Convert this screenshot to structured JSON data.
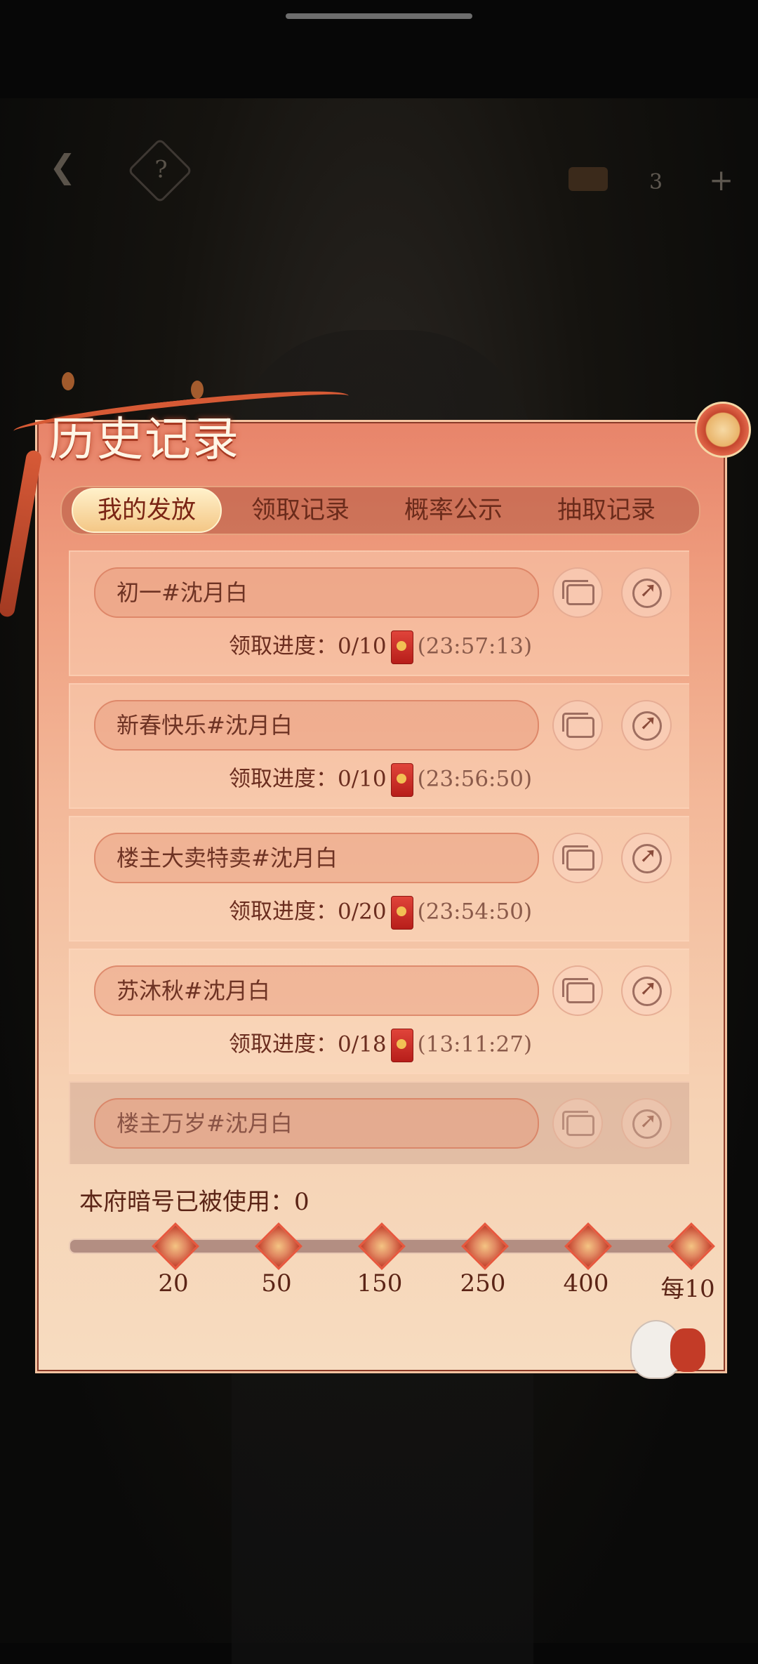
{
  "topbar": {
    "back_icon": "back-arrow-icon",
    "help_label": "?",
    "currency_count": "3",
    "plus_label": "+"
  },
  "panel": {
    "title": "历史记录",
    "tabs": [
      {
        "label": "我的发放",
        "active": true
      },
      {
        "label": "领取记录",
        "active": false
      },
      {
        "label": "概率公示",
        "active": false
      },
      {
        "label": "抽取记录",
        "active": false
      }
    ],
    "records": [
      {
        "name": "初一#沈月白",
        "progress_label": "领取进度：",
        "progress": "0/10",
        "timer": "(23:57:13)"
      },
      {
        "name": "新春快乐#沈月白",
        "progress_label": "领取进度：",
        "progress": "0/10",
        "timer": "(23:56:50)"
      },
      {
        "name": "楼主大卖特卖#沈月白",
        "progress_label": "领取进度：",
        "progress": "0/20",
        "timer": "(23:54:50)"
      },
      {
        "name": "苏沐秋#沈月白",
        "progress_label": "领取进度：",
        "progress": "0/18",
        "timer": "(13:11:27)"
      },
      {
        "name": "楼主万岁#沈月白"
      }
    ],
    "usage": {
      "label": "本府暗号已被使用：",
      "count": "0",
      "milestones": [
        "20",
        "50",
        "150",
        "250",
        "400",
        "每10"
      ]
    }
  },
  "colors": {
    "accent": "#c33b27",
    "text_primary": "#6b2d1f",
    "title": "#fff6e6"
  }
}
